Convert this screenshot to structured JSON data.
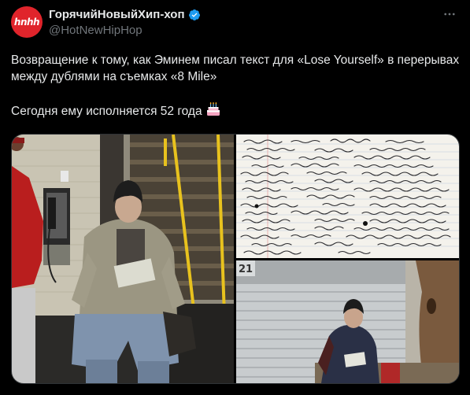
{
  "author": {
    "avatar_text": "hnhh",
    "display_name": "ГорячийНовыйХип-хоп",
    "handle": "@HotNewHipHop",
    "verified": true,
    "verified_icon": "verified-badge-icon"
  },
  "more_icon": "more-options-icon",
  "tweet": {
    "line1": "Возвращение к тому, как Эминем писал текст для «Lose Yourself» в перерывах между дублями на съемках «8 Mile»",
    "line2": "Сегодня ему исполняется 52 года",
    "emoji": "birthday-cake-icon"
  },
  "media": {
    "left_sign": "",
    "bottom_right_sign": "21"
  },
  "colors": {
    "background": "#000000",
    "text": "#e7e9ea",
    "muted": "#71767b",
    "avatar": "#e0242b",
    "verified": "#1d9bf0"
  }
}
